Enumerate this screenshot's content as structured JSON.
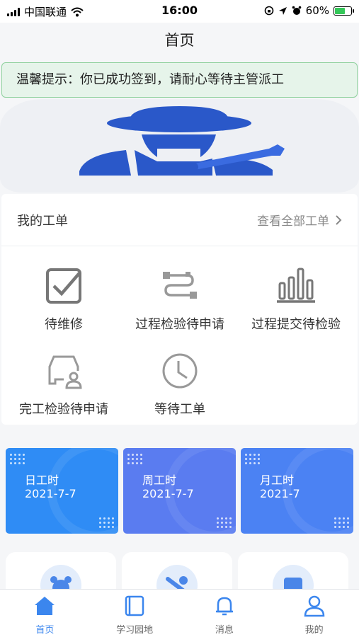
{
  "status_bar": {
    "carrier": "中国联通",
    "time": "16:00",
    "battery": "60%"
  },
  "page": {
    "title": "首页"
  },
  "notice": {
    "text": "温馨提示：你已成功签到，请耐心等待主管派工"
  },
  "work_orders": {
    "title": "我的工单",
    "view_all": "查看全部工单",
    "items": [
      {
        "label": "待维修",
        "icon": "checkbox-icon"
      },
      {
        "label": "过程检验待申请",
        "icon": "process-flow-icon"
      },
      {
        "label": "过程提交待检验",
        "icon": "bar-chart-icon"
      },
      {
        "label": "完工检验待申请",
        "icon": "car-inspector-icon"
      },
      {
        "label": "等待工单",
        "icon": "clock-icon"
      }
    ]
  },
  "stats": [
    {
      "label": "日工时",
      "date": "2021-7-7",
      "color": "#2f8cf5"
    },
    {
      "label": "周工时",
      "date": "2021-7-7",
      "color": "#5a7cf0"
    },
    {
      "label": "月工时",
      "date": "2021-7",
      "color": "#4b82f3"
    }
  ],
  "tabbar": [
    {
      "label": "首页",
      "icon": "home-icon",
      "active": true
    },
    {
      "label": "学习园地",
      "icon": "book-icon",
      "active": false
    },
    {
      "label": "消息",
      "icon": "bell-icon",
      "active": false
    },
    {
      "label": "我的",
      "icon": "user-icon",
      "active": false
    }
  ],
  "colors": {
    "accent": "#3b86ee",
    "notice_bg": "#e6f4ea",
    "notice_border": "#8fd19e",
    "banner_figure": "#2a58c9"
  }
}
